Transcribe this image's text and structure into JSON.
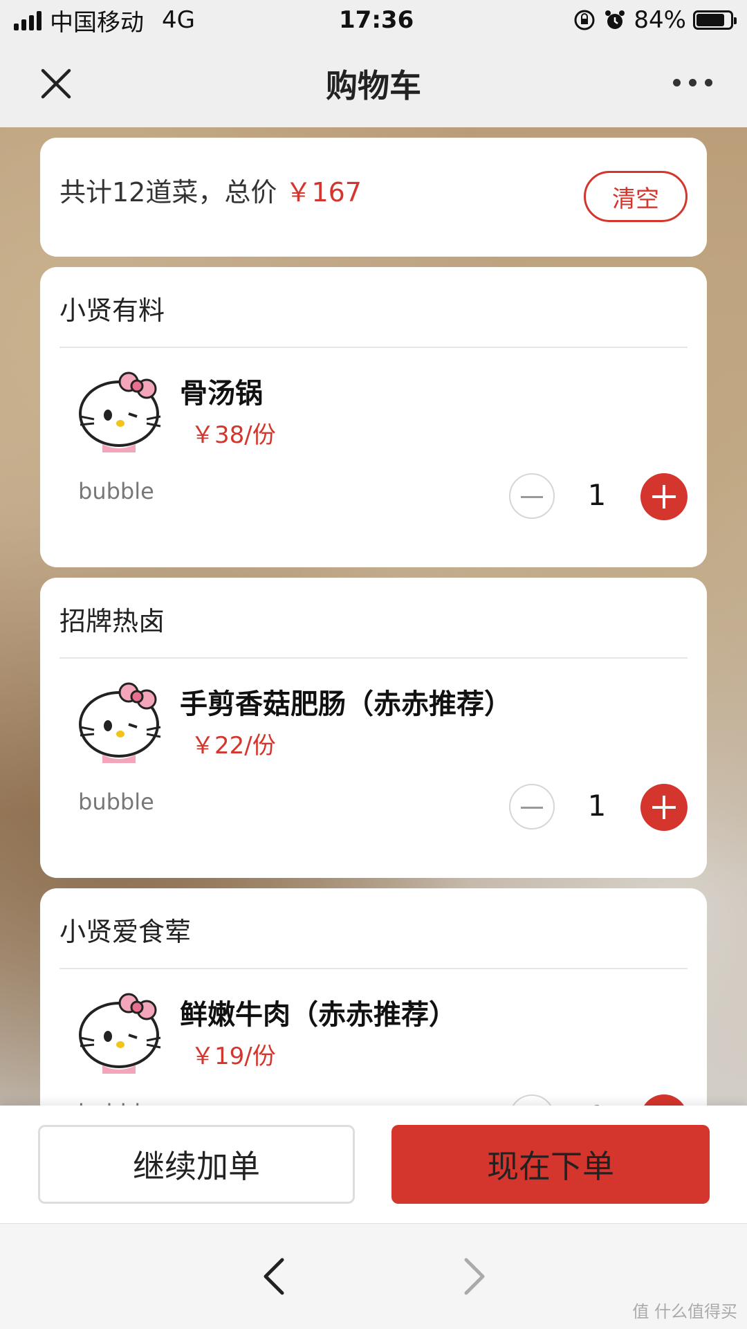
{
  "status_bar": {
    "carrier": "中国移动",
    "network": "4G",
    "time": "17:36",
    "battery": "84%",
    "battery_level": 0.84
  },
  "nav": {
    "title": "购物车",
    "close_icon": "close-icon",
    "more_icon": "more-dots-icon"
  },
  "summary": {
    "prefix": "共计12道菜，总价",
    "price": "￥167",
    "clear_label": "清空"
  },
  "groups": [
    {
      "title": "小贤有料",
      "item": {
        "name": "骨汤锅",
        "price": "￥38/份",
        "note": "bubble",
        "qty": "1"
      }
    },
    {
      "title": "招牌热卤",
      "item": {
        "name": "手剪香菇肥肠（赤赤推荐）",
        "price": "￥22/份",
        "note": "bubble",
        "qty": "1"
      }
    },
    {
      "title": "小贤爱食荤",
      "item": {
        "name": "鲜嫩牛肉（赤赤推荐）",
        "price": "￥19/份",
        "note": "bubble",
        "qty": "1"
      }
    }
  ],
  "actions": {
    "continue_label": "继续加单",
    "order_label": "现在下单"
  },
  "browser": {
    "back_icon": "chevron-left-icon",
    "forward_icon": "chevron-right-icon"
  },
  "watermark": "值 什么值得买",
  "colors": {
    "accent": "#d4352c",
    "bar_bg": "#efefef"
  }
}
